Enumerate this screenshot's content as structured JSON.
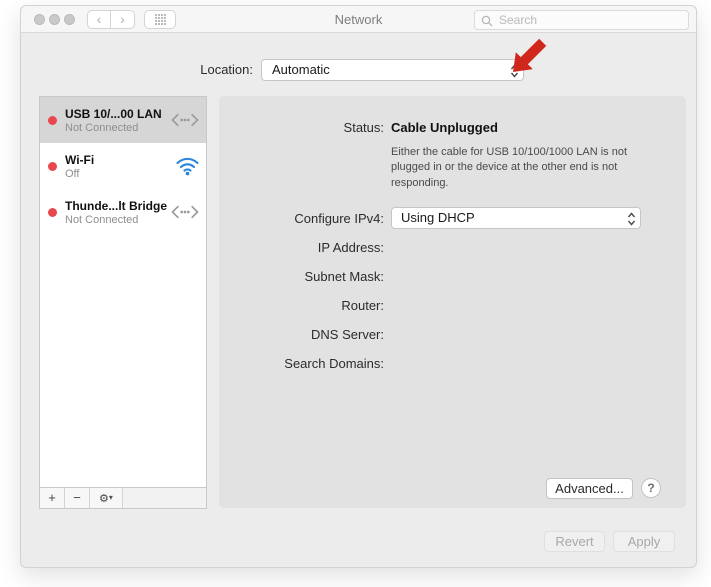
{
  "titlebar": {
    "title": "Network",
    "back_glyph": "‹",
    "forward_glyph": "›",
    "search_placeholder": "Search"
  },
  "location_row": {
    "label": "Location:",
    "value": "Automatic"
  },
  "sidebar": {
    "items": [
      {
        "name": "USB 10/...00 LAN",
        "status": "Not Connected",
        "icon": "ethernet",
        "selected": true
      },
      {
        "name": "Wi-Fi",
        "status": "Off",
        "icon": "wifi",
        "selected": false
      },
      {
        "name": "Thunde...lt Bridge",
        "status": "Not Connected",
        "icon": "ethernet",
        "selected": false
      }
    ],
    "actions": {
      "add": "+",
      "remove": "−",
      "gear": "⚙",
      "gear_chevron": "▾"
    }
  },
  "main": {
    "status_label": "Status:",
    "status_value": "Cable Unplugged",
    "status_description": "Either the cable for USB 10/100/1000 LAN is not plugged in or the device at the other end is not responding.",
    "fields": [
      {
        "label": "Configure IPv4:",
        "value": "Using DHCP",
        "type": "select"
      },
      {
        "label": "IP Address:",
        "value": ""
      },
      {
        "label": "Subnet Mask:",
        "value": ""
      },
      {
        "label": "Router:",
        "value": ""
      },
      {
        "label": "DNS Server:",
        "value": ""
      },
      {
        "label": "Search Domains:",
        "value": ""
      }
    ],
    "advanced_button": "Advanced...",
    "help_button": "?"
  },
  "footer": {
    "revert": "Revert",
    "apply": "Apply"
  },
  "colors": {
    "status_dot_red": "#e8474e",
    "wifi_blue": "#2a85dc",
    "annotation_arrow_red": "#d0271c",
    "selection_gray": "#d6d6d6"
  }
}
